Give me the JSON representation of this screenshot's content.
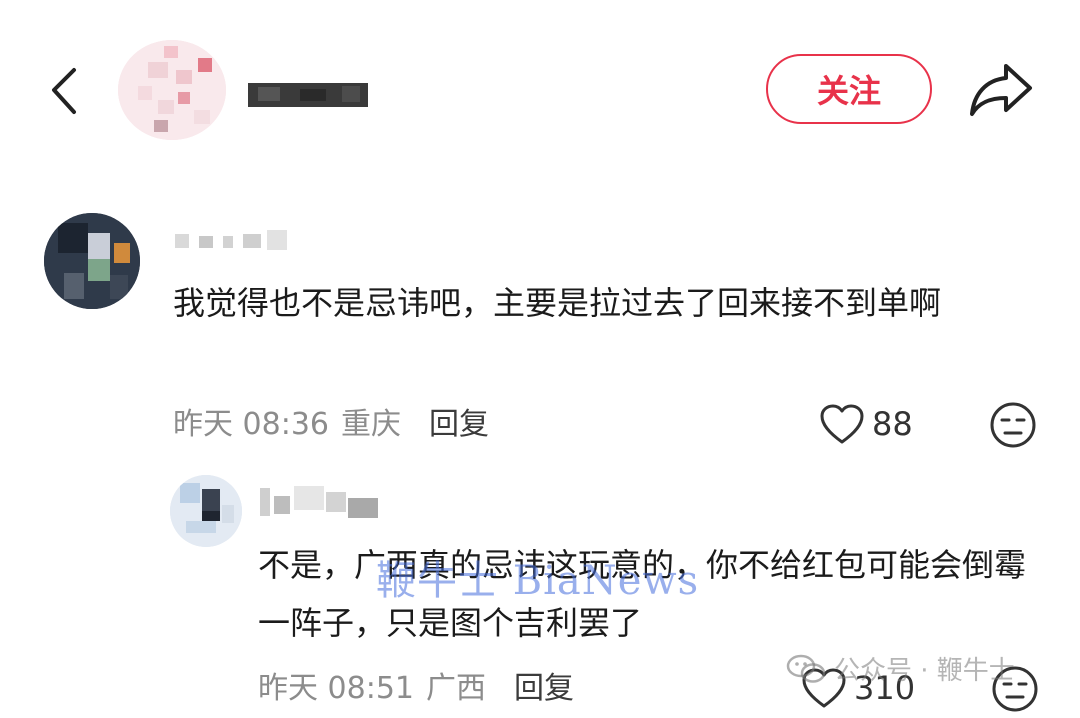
{
  "header": {
    "follow_label": "关注",
    "icons": {
      "back": "chevron-left-icon",
      "share": "share-arrow-icon"
    }
  },
  "comments": [
    {
      "text": "我觉得也不是忌讳吧，主要是拉过去了回来接不到单啊",
      "time": "昨天 08:36",
      "location": "重庆",
      "reply_label": "回复",
      "likes": "88"
    },
    {
      "text": "不是，广西真的忌讳这玩意的，你不给红包可能会倒霉一阵子，只是图个吉利罢了",
      "time": "昨天 08:51",
      "location": "广西",
      "reply_label": "回复",
      "likes": "310"
    }
  ],
  "watermarks": {
    "center": "鞭牛士 BiaNews",
    "corner": "公众号 · 鞭牛士"
  },
  "colors": {
    "accent": "#e8324a",
    "meta_gray": "#8c8c8c",
    "text": "#1b1b1b"
  }
}
